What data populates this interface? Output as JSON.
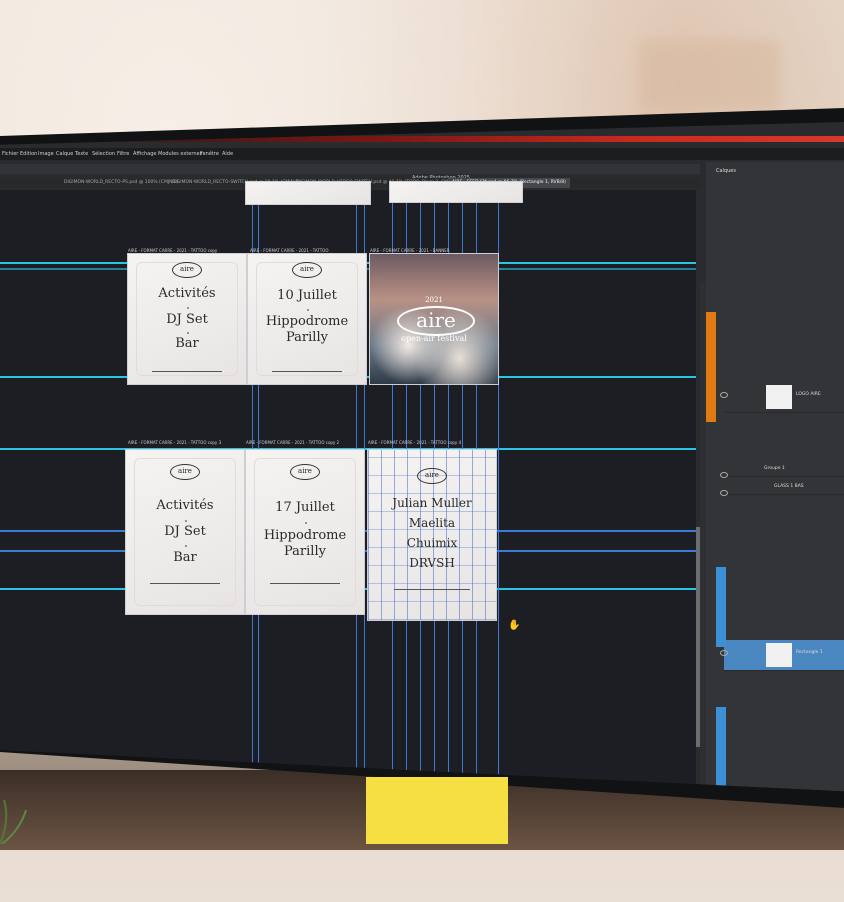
{
  "app": {
    "title": "Adobe Photoshop 2025",
    "menu": [
      "Fichier",
      "Edition",
      "Image",
      "Calque",
      "Texte",
      "Sélection",
      "Filtre",
      "Affichage",
      "Modules externes",
      "Fenêtre",
      "Aide"
    ]
  },
  "tabs": [
    {
      "label": "DIGIMON-WORLD_RECTO-PS.psd @ 100% (CMJN/8)",
      "active": false
    },
    {
      "label": "DIGIMON-WORLD_RECTO-SWITCH.psd @ 20,1% (CMJN/8)",
      "active": false
    },
    {
      "label": "DIGIMON-WORLD_VERSO-SWITCH.psd @ 41,1% (TODO_Black 2, CMJN/8)",
      "active": false
    },
    {
      "label": "AIRE - FEED SM.psd @ 66,7% (Rectangle 1, RVB/8)",
      "active": true
    }
  ],
  "artboards": {
    "row1": [
      {
        "label": "AIRE - FORMAT CARRE - 2021 - TATTOO copy",
        "logo": "aire",
        "lines": [
          "Activités",
          "DJ Set",
          "Bar"
        ]
      },
      {
        "label": "AIRE - FORMAT CARRE - 2021 - TATTOO",
        "logo": "aire",
        "lines": [
          "10 Juillet",
          "Hippodrome",
          "Parilly"
        ]
      },
      {
        "label": "AIRE - FORMAT CARRE - 2021 - BANNER",
        "logo": "aire",
        "year": "2021",
        "subtitle": "open-air festival"
      }
    ],
    "row2": [
      {
        "label": "AIRE - FORMAT CARRE - 2021 - TATTOO copy 3",
        "logo": "aire",
        "lines": [
          "Activités",
          "DJ Set",
          "Bar"
        ]
      },
      {
        "label": "AIRE - FORMAT CARRE - 2021 - TATTOO copy 2",
        "logo": "aire",
        "lines": [
          "17 Juillet",
          "Hippodrome",
          "Parilly"
        ]
      },
      {
        "label": "AIRE - FORMAT CARRE - 2021 - TATTOO copy 4",
        "logo": "aire",
        "lines": [
          "Julian Muller",
          "Maelita",
          "Chuimix",
          "DRVSH"
        ]
      }
    ]
  },
  "layers_panel": {
    "title": "Calques",
    "layers": [
      "LOGO AIRE",
      "Groupe 1",
      "GLASS 1 BAS",
      "Rectangle 1"
    ]
  },
  "colors": {
    "guide_cyan": "#29c5e5",
    "guide_blue": "#3d7ad8",
    "accent_orange": "#e07a15",
    "selection_blue": "#4a87c0"
  }
}
